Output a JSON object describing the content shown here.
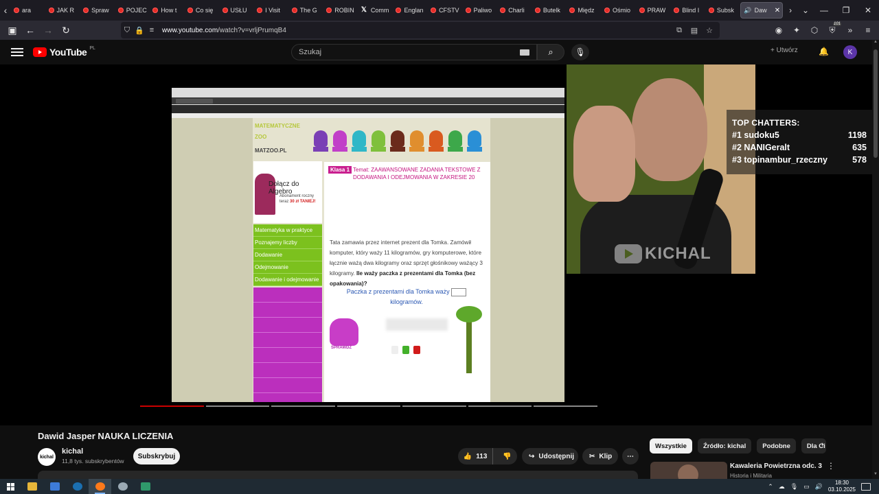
{
  "browser": {
    "tabs": [
      {
        "label": "ara",
        "icon": "youtube-icon"
      },
      {
        "label": "JAK R",
        "icon": "youtube-icon"
      },
      {
        "label": "Spraw",
        "icon": "youtube-icon"
      },
      {
        "label": "POJEC",
        "icon": "youtube-icon"
      },
      {
        "label": "How t",
        "icon": "youtube-icon"
      },
      {
        "label": "Co się",
        "icon": "youtube-icon"
      },
      {
        "label": "USŁU",
        "icon": "youtube-icon"
      },
      {
        "label": "I Visit",
        "icon": "youtube-icon"
      },
      {
        "label": "The G",
        "icon": "youtube-icon"
      },
      {
        "label": "ROBIN",
        "icon": "youtube-icon"
      },
      {
        "label": "Comm",
        "icon": "x-icon"
      },
      {
        "label": "Englan",
        "icon": "youtube-icon"
      },
      {
        "label": "CFSTV",
        "icon": "youtube-icon"
      },
      {
        "label": "Paliwo",
        "icon": "youtube-icon"
      },
      {
        "label": "Charli",
        "icon": "youtube-icon"
      },
      {
        "label": "Butelk",
        "icon": "youtube-icon"
      },
      {
        "label": "Międz",
        "icon": "youtube-icon"
      },
      {
        "label": "Ośmio",
        "icon": "youtube-icon"
      },
      {
        "label": "PRAW",
        "icon": "youtube-icon"
      },
      {
        "label": "Blind I",
        "icon": "youtube-icon"
      },
      {
        "label": "Subsk",
        "icon": "youtube-icon"
      }
    ],
    "active_tab": {
      "label": "Daw",
      "icon": "speaker-icon"
    },
    "url_domain": "www.youtube.com",
    "url_path": "/watch?v=vrljPrumqB4",
    "extension_badge": "101"
  },
  "youtube": {
    "logo_text": "YouTube",
    "logo_region": "PL",
    "search_placeholder": "Szukaj",
    "create_label": "Utwórz",
    "avatar_letter": "K"
  },
  "video": {
    "shared_screen": {
      "site_logo": "MATEMATYCZNE ZOO",
      "site_domain": "MATZOO.PL",
      "promo_title": "Dołącz do Algebro",
      "promo_sub": "Abonament roczny teraz",
      "promo_price": "30 zł TANIEJ!",
      "green_nav": [
        "Matematyka w praktyce",
        "Poznajemy liczby",
        "Dodawanie",
        "Odejmowanie",
        "Dodawanie i odejmowanie"
      ],
      "klasa": "Klasa 1",
      "temat": "Temat: ZAAWANSOWANE ZADANIA TEKSTOWE Z DODAWANIA I ODEJMOWANIA W ZAKRESIE 20",
      "task_text": "Tata zamawia przez internet prezent dla Tomka. Zamówił komputer, który waży 11 kilogramów, gry komputerowe, które łącznie ważą dwa kilogramy oraz sprzęt głośnikowy ważący 3 kilogramy.",
      "task_question": "Ile waży paczka z prezentami dla Tomka (bez opakowania)?",
      "answer_prefix": "Paczka z prezentami dla Tomka waży",
      "answer_suffix": "kilogramów.",
      "check_label": "SPRAWDŹ"
    },
    "watermark": "KICHAL",
    "top_chatters": {
      "title": "TOP CHATTERS:",
      "rows": [
        {
          "rank": "#1",
          "name": "sudoku5",
          "count": "1198"
        },
        {
          "rank": "#2",
          "name": "NANIGeralt",
          "count": "635"
        },
        {
          "rank": "#3",
          "name": "topinambur_rzeczny",
          "count": "578"
        }
      ]
    }
  },
  "meta": {
    "title": "Dawid Jasper NAUKA LICZENIA",
    "channel": "kichal",
    "channel_avatar": "kichal",
    "subscribers": "11,8 tys. subskrybentów",
    "subscribe": "Subskrybuj",
    "likes": "113",
    "share": "Udostępnij",
    "clip": "Klip"
  },
  "sidebar": {
    "chips": [
      "Wszystkie",
      "Źródło: kichal",
      "Podobne",
      "Dla Ci"
    ],
    "rec_title": "Kawaleria Powietrzna  odc. 3",
    "rec_channel": "Historia i Militaria"
  },
  "taskbar": {
    "time": "18:30",
    "date": "03.10.2025"
  },
  "colors": {
    "youtube_red": "#ff0000",
    "matzo_green": "#7cc11e",
    "matzo_purple": "#bb2fbd"
  }
}
